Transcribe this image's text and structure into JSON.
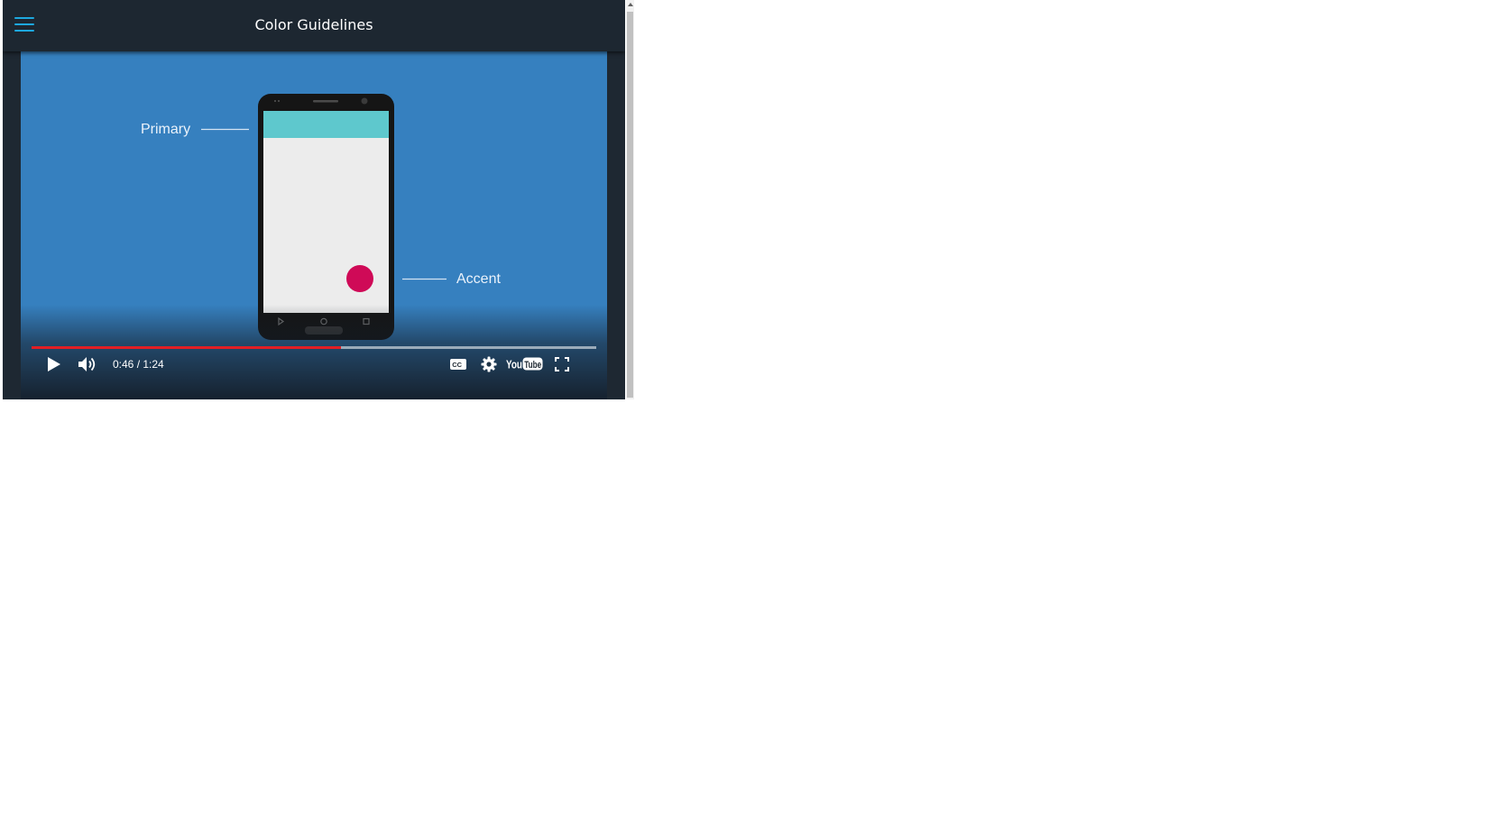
{
  "header": {
    "title": "Color Guidelines",
    "menu_icon": "hamburger-menu-icon",
    "accent_color": "#1da8df"
  },
  "video": {
    "labels": {
      "primary": "Primary",
      "accent": "Accent"
    },
    "colors": {
      "background": "#3680bf",
      "primary": "#5ec8cd",
      "accent": "#cf0a57",
      "progress": "#e31e24"
    },
    "time": "0:46 / 1:24",
    "progress_fraction": 0.548,
    "controls": {
      "play_icon": "play-icon",
      "volume_icon": "volume-icon",
      "captions_icon": "closed-captions-icon",
      "settings_icon": "gear-icon",
      "youtube_logo": "YouTube",
      "fullscreen_icon": "fullscreen-icon"
    }
  }
}
